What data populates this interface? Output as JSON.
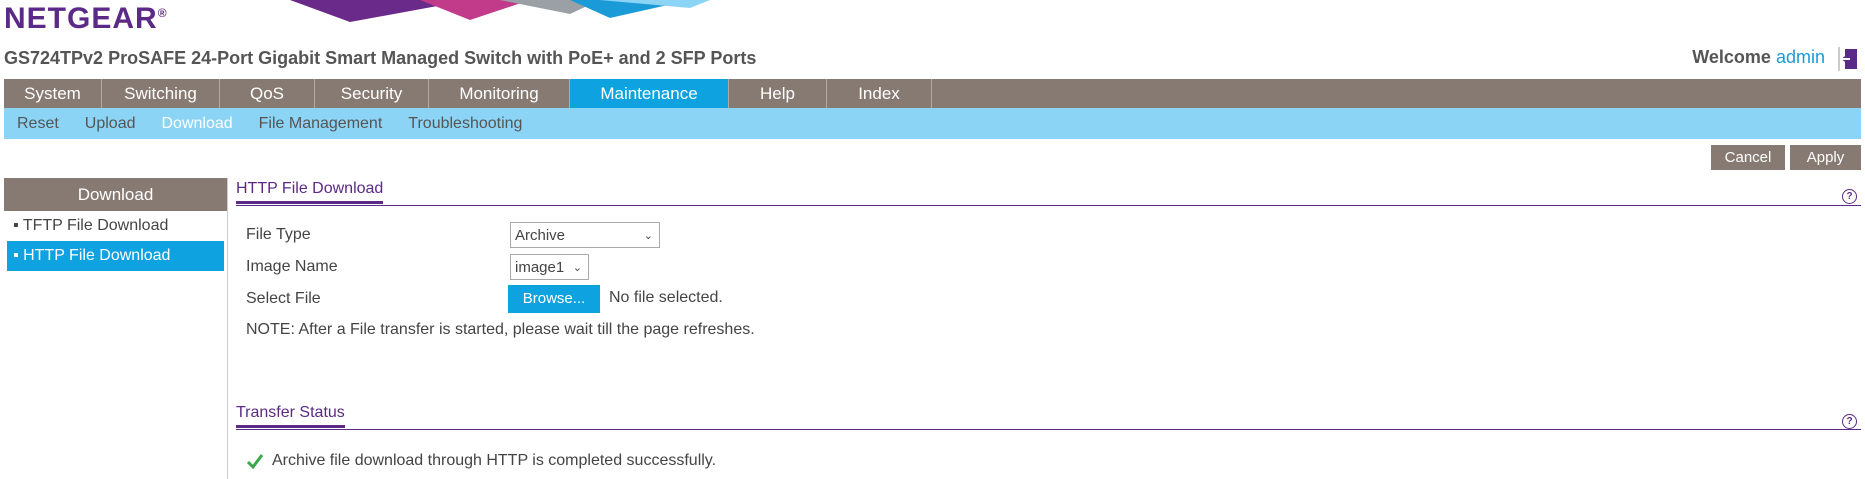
{
  "brand": {
    "logo": "NETGEAR",
    "trademark": "®"
  },
  "header": {
    "model": "GS724TPv2 ProSAFE 24-Port Gigabit Smart Managed Switch with PoE+ and 2 SFP Ports",
    "welcome": "Welcome",
    "user": "admin"
  },
  "main_nav": [
    "System",
    "Switching",
    "QoS",
    "Security",
    "Monitoring",
    "Maintenance",
    "Help",
    "Index"
  ],
  "sub_nav": [
    "Reset",
    "Upload",
    "Download",
    "File Management",
    "Troubleshooting"
  ],
  "actions": {
    "cancel": "Cancel",
    "apply": "Apply"
  },
  "sidebar": {
    "title": "Download",
    "items": [
      "TFTP File Download",
      "HTTP File Download"
    ]
  },
  "http_section": {
    "title": "HTTP File Download",
    "file_type_label": "File Type",
    "file_type_value": "Archive",
    "image_name_label": "Image Name",
    "image_name_value": "image1",
    "select_file_label": "Select File",
    "browse_label": "Browse...",
    "no_file": "No file selected.",
    "note": "NOTE: After a File transfer is started, please wait till the page refreshes."
  },
  "transfer_section": {
    "title": "Transfer Status",
    "message": "Archive file download through HTTP is completed successfully."
  },
  "colors": {
    "brand_purple": "#5b2a86",
    "accent_blue": "#0ea3e0",
    "nav_gray": "#877a72",
    "subnav_blue": "#8cd4f5"
  },
  "icons": {
    "help": "?",
    "logout": "logout-icon",
    "check": "check-icon"
  }
}
